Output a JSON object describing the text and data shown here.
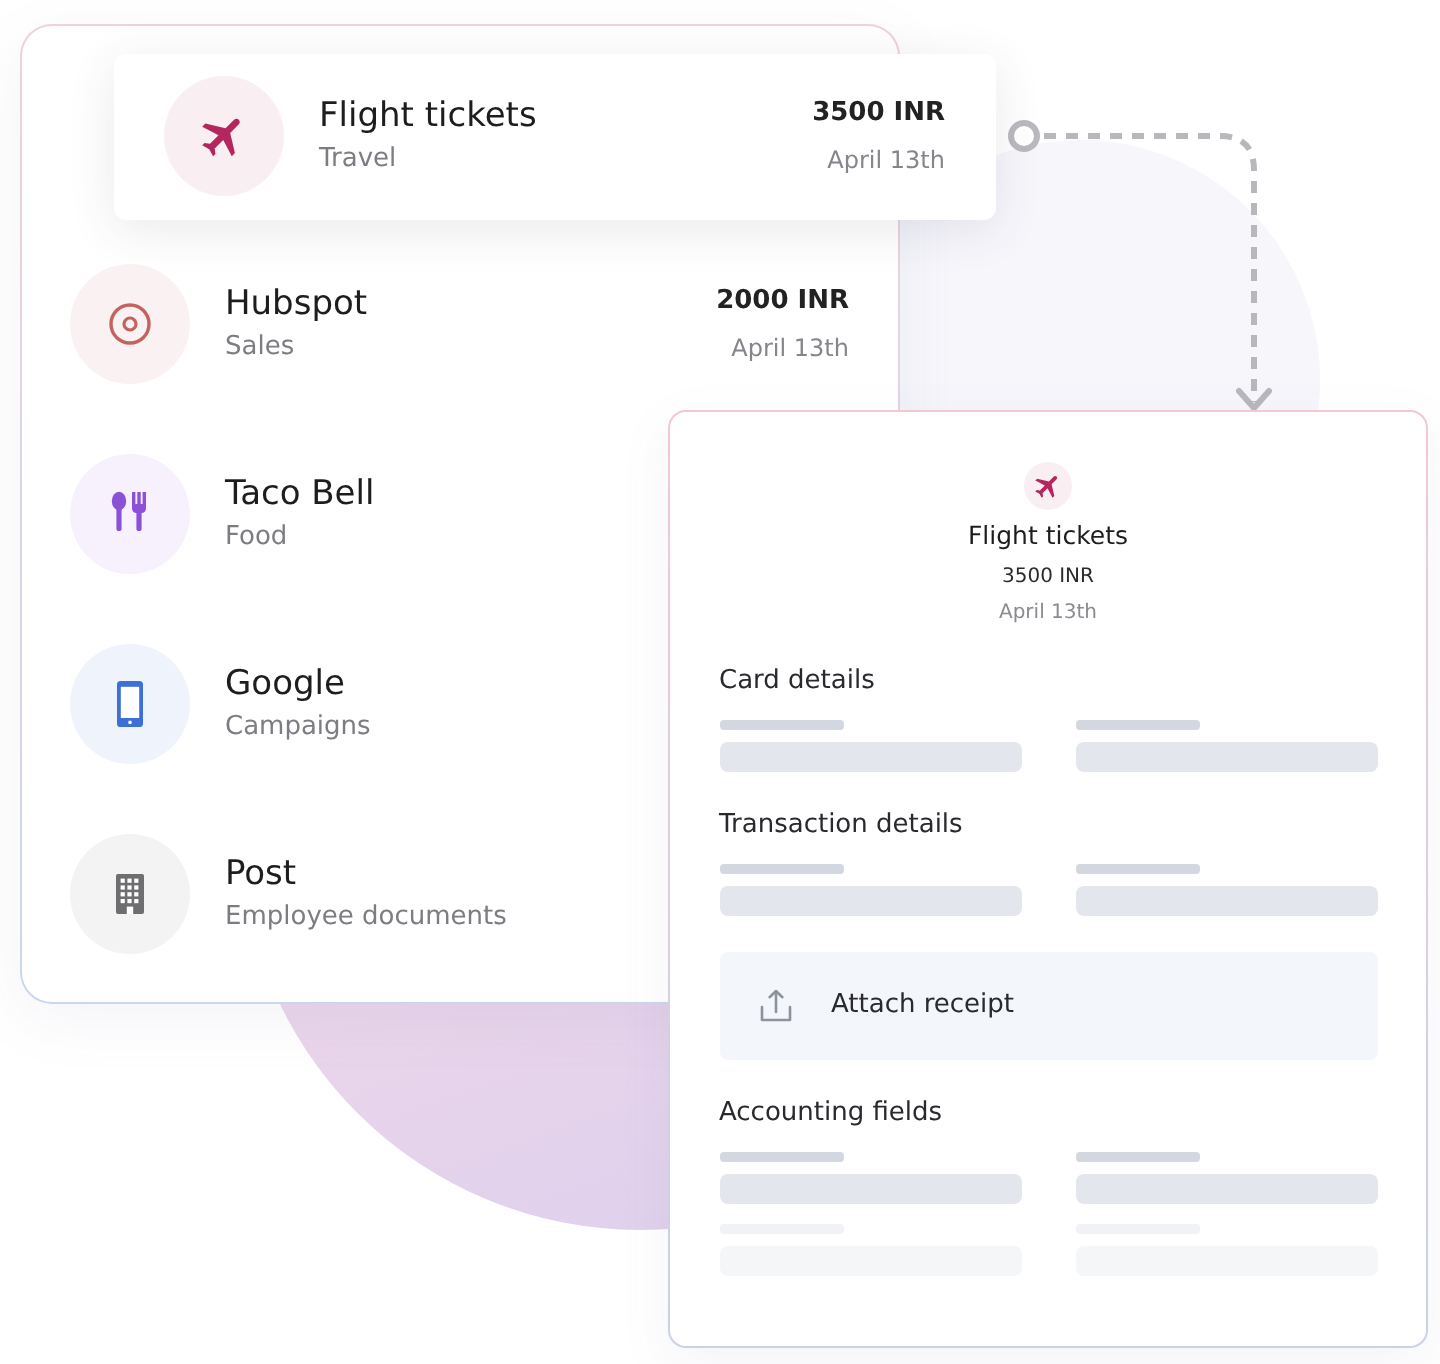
{
  "transactions": [
    {
      "title": "Flight tickets",
      "category": "Travel",
      "amount": "3500 INR",
      "date": "April 13th",
      "kind": "travel",
      "color": "#b3265e",
      "selected": true
    },
    {
      "title": "Hubspot",
      "category": "Sales",
      "amount": "2000 INR",
      "date": "April 13th",
      "kind": "sales",
      "color": "#c4625f",
      "selected": false
    },
    {
      "title": "Taco Bell",
      "category": "Food",
      "kind": "food",
      "color": "#8b52d8",
      "selected": false
    },
    {
      "title": "Google",
      "category": "Campaigns",
      "kind": "campaigns",
      "color": "#3d6fd9",
      "selected": false
    },
    {
      "title": "Post",
      "category": "Employee documents",
      "kind": "documents",
      "color": "#6e6e70",
      "selected": false
    }
  ],
  "detail": {
    "title": "Flight tickets",
    "amount": "3500 INR",
    "date": "April 13th",
    "kind": "travel",
    "color": "#b3265e",
    "sections": [
      {
        "kind": "form",
        "title": "Card details",
        "rows": [
          {
            "faded": false
          }
        ]
      },
      {
        "kind": "form",
        "title": "Transaction details",
        "rows": [
          {
            "faded": false
          }
        ]
      },
      {
        "kind": "upload",
        "label": "Attach receipt"
      },
      {
        "kind": "form",
        "title": "Accounting fields",
        "rows": [
          {
            "faded": false
          },
          {
            "faded": true
          }
        ]
      }
    ]
  }
}
